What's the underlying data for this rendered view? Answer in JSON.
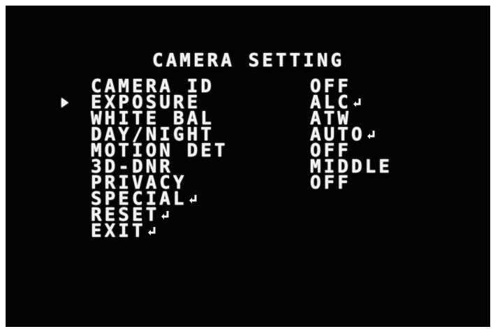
{
  "menu": {
    "title": "CAMERA SETTING",
    "selected_index": 1,
    "items": [
      {
        "label": "CAMERA ID",
        "value": "OFF"
      },
      {
        "label": "EXPOSURE",
        "value": "ALC",
        "value_icon": "enter-icon"
      },
      {
        "label": "WHITE BAL",
        "value": "ATW"
      },
      {
        "label": "DAY/NIGHT",
        "value": "AUTO",
        "value_icon": "enter-icon"
      },
      {
        "label": "MOTION DET",
        "value": "OFF"
      },
      {
        "label": "3D-DNR",
        "value": "MIDDLE"
      },
      {
        "label": "PRIVACY",
        "value": "OFF"
      },
      {
        "label": "SPECIAL",
        "label_icon": "enter-icon"
      },
      {
        "label": "RESET",
        "label_icon": "enter-icon"
      },
      {
        "label": "EXIT",
        "label_icon": "enter-icon"
      }
    ]
  },
  "colors": {
    "background": "#040404",
    "text": "#f2f2f2",
    "border": "#ffffff"
  }
}
